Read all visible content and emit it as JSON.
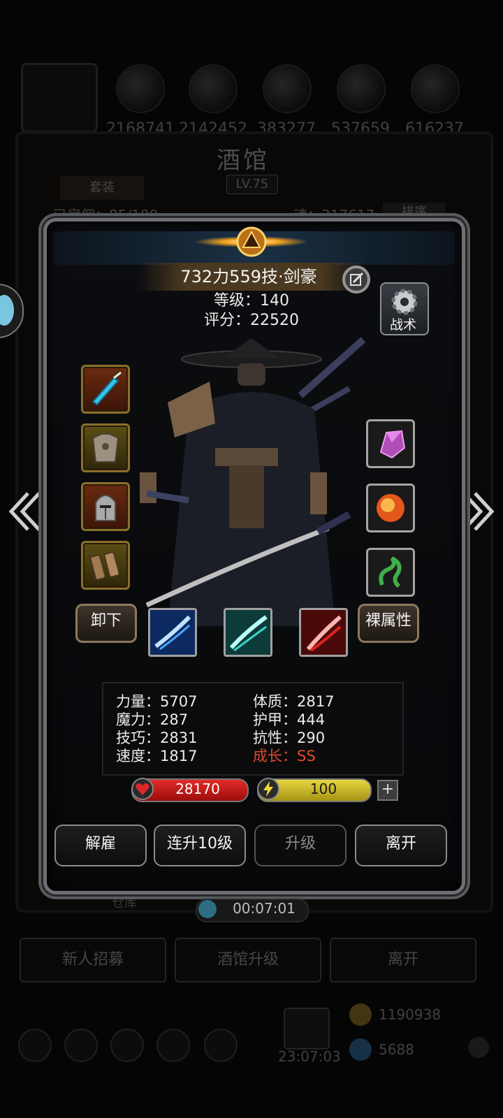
{
  "background": {
    "resources": [
      "2168741",
      "2142452",
      "383277",
      "537659",
      "616237"
    ],
    "title": "酒馆",
    "level": "LV.75",
    "tab_label": "套装",
    "row_left": "已雇佣：85/100",
    "row_right": "魂：317617",
    "sort_label": "排序",
    "recruit_button": "新人招募",
    "upgrade_button": "酒馆升级",
    "leave_button": "离开",
    "warehouse_label": "仓库",
    "gold": "1190938",
    "gems": "5688",
    "clock": "23:07:03"
  },
  "hero": {
    "name": "732力559技·剑豪",
    "level_line": "等级：140",
    "score_line": "评分：22520",
    "tactics_label": "战术",
    "unequip_label": "卸下",
    "base_attr_label": "裸属性"
  },
  "equipment": {
    "left": [
      "weapon-sword-icon",
      "armor-chest-icon",
      "helmet-icon",
      "bracers-icon"
    ],
    "right": [
      "crystal-gem-icon",
      "fire-orb-icon",
      "jade-dragon-icon"
    ]
  },
  "skills": [
    "blue-slash-skill-icon",
    "cyan-slash-skill-icon",
    "red-slash-skill-icon"
  ],
  "attributes": {
    "strength": "力量：5707",
    "magic": "魔力：287",
    "skill": "技巧：2831",
    "speed": "速度：1817",
    "constitution": "体质：2817",
    "armor": "护甲：444",
    "resistance": "抗性：290",
    "growth": "成长：SS"
  },
  "bars": {
    "hp": "28170",
    "energy": "100",
    "plus": "+"
  },
  "actions": {
    "dismiss": "解雇",
    "level_up_10": "连升10级",
    "level_up": "升级",
    "leave": "离开"
  },
  "timer": "00:07:01",
  "colors": {
    "growth_warning": "#e14a2f",
    "hp_red": "#e22b28",
    "energy_yellow": "#e6d640",
    "frame_gray": "#6d6f73"
  }
}
